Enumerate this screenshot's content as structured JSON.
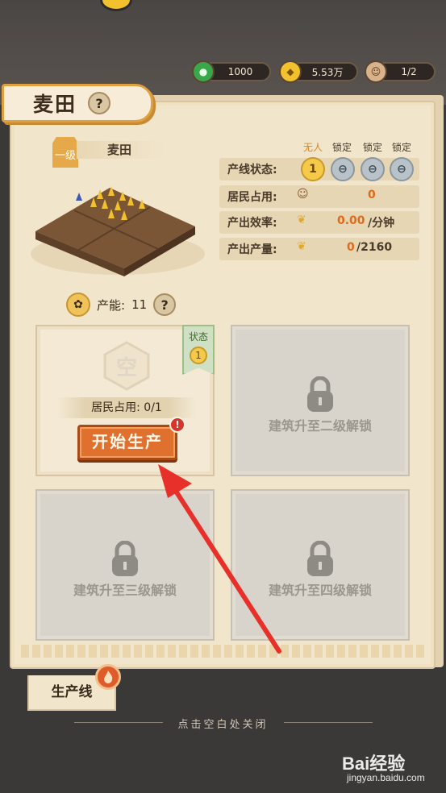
{
  "resources": {
    "gem": "1000",
    "coin": "5.53万",
    "residents": "1/2"
  },
  "building": {
    "title": "麦田",
    "level_label": "一级",
    "name": "麦田",
    "capacity_label": "产能:",
    "capacity_value": "11"
  },
  "status": {
    "headers": [
      "无人",
      "锁定",
      "锁定",
      "锁定"
    ],
    "line_state_label": "产线状态:",
    "slots": [
      "1",
      "locked",
      "locked",
      "locked"
    ],
    "residents_label": "居民占用:",
    "residents_value": "0",
    "efficiency_label": "产出效率:",
    "efficiency_value": "0.00",
    "efficiency_unit": "/分钟",
    "output_label": "产出产量:",
    "output_current": "0",
    "output_max": "/2160"
  },
  "slot_cards": {
    "active": {
      "empty_char": "空",
      "state_label": "状态",
      "state_value": "1",
      "occupancy": "居民占用: 0/1",
      "start_button": "开始生产",
      "alert": "!"
    },
    "lock2": "建筑升至二级解锁",
    "lock3": "建筑升至三级解锁",
    "lock4": "建筑升至四级解锁"
  },
  "bottom_tab": "生产线",
  "close_hint": "点击空白处关闭",
  "watermark": {
    "brand": "Bai经验",
    "url": "jingyan.baidu.com"
  },
  "colors": {
    "panel": "#f1e5cc",
    "accent_orange": "#e0702e",
    "active_slot": "#f5c94a",
    "locked_slot": "#b8c2c8",
    "arrow": "#e8302a"
  }
}
